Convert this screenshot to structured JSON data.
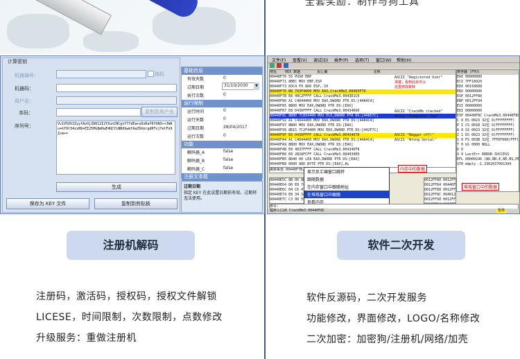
{
  "top_right": {
    "caption": "全套奖励：制作与狗工具"
  },
  "keygen": {
    "group_title": "计算密钥",
    "fields": [
      {
        "label": "机器编号：",
        "value": "",
        "checkbox": "随机"
      },
      {
        "label": "机器码：",
        "value": ""
      },
      {
        "label": "用户名：",
        "value": ""
      },
      {
        "label": "本码：",
        "value": "",
        "button": "复制到用户名"
      }
    ],
    "serial_label": "序列号：",
    "serial_value": "Vv1V5OV2ZyyfAvOjZ8812I2YXunCNCgvY7fdEa+vDoRaY6YhN3++JWAu+kY9l34zsN9+EI25HG8mDwE4QCYiNNXGwmfAaZ6kkrgdRTvjYetFn9Zcm+=",
    "generate_button": "生成",
    "save_button": "保存为 KEY 文件",
    "copy_button": "复制到剪贴板",
    "section_basic_title": "基础信息",
    "basic_items": [
      {
        "label": "有效天数",
        "value": "0"
      },
      {
        "label": "过期日期",
        "value": "31/10/2030"
      },
      {
        "label": "执行次数",
        "value": "0"
      }
    ],
    "section_run_title": "运行限制",
    "run_items": [
      {
        "label": "运行时间",
        "value": "0"
      },
      {
        "label": "运行天数",
        "value": "0"
      },
      {
        "label": "过期日期",
        "value": "28/04/2017"
      },
      {
        "label": "运行次数",
        "value": "0"
      }
    ],
    "section_feature_title": "功能",
    "feature_items": [
      {
        "label": "解码器_A",
        "value": "false"
      },
      {
        "label": "解码器_B",
        "value": "false"
      },
      {
        "label": "解码器_C",
        "value": "false"
      }
    ],
    "notes_title": "注册文本框",
    "desc_title": "过期日期",
    "desc_text": "指定 KEY 在此设置日期前有效，过期将无法使用。"
  },
  "olly": {
    "menubar": [
      "文件(F)",
      "查看(V)",
      "调试(D)",
      "插件(P)",
      "选项(T)",
      "窗口(W)",
      "帮助(H)"
    ],
    "col_headers": [
      "地址",
      "HEX 数据",
      "反汇编",
      "注释",
      "寄存器 (FPU)"
    ],
    "code_rows": [
      "00440F70  55        PUSH EBP",
      "00440F71  8BEC      MOV EBP,ESP",
      "00440F73  83C4 F0   ADD ESP,-10",
      "00440F76  B8 703F4000 MOV EAX,CrackMe3.00403F70",
      "00440F7B  E8 40C2FFFF CALL CrackMe3.0043D1C0",
      "00440F80  A1 C4844400 MOV EAX,DWORD PTR DS:[4484C4]",
      "00440F85  8B00      MOV EAX,DWORD PTR DS:[EAX]",
      "00440F87  E8 D436FFFF CALL CrackMe3.00434660",
      "00440F8C  8B0D 7C854400 MOV ECX,DWORD PTR DS:[44857C]",
      "00440F92  A1 C4844400 MOV EAX,DWORD PTR DS:[4484C4]",
      "00440F97  8B00      MOV EAX,DWORD PTR DS:[EAX]",
      "00440F99  8B15 7C2F4400 MOV EDX,DWORD PTR DS:[442F7C]",
      "00440F9F  E8 D436FFFF CALL CrackMe3.00434678",
      "00440FA4  A1 C4844400 MOV EAX,DWORD PTR DS:[4484C4]",
      "00440FA9  8B00      MOV EAX,DWORD PTR DS:[EAX]",
      "00440FAB  E8 4837FFFF CALL CrackMe3.004346F8",
      "00440FB0  E8 2B2AFCFF CALL CrackMe3.004039E0",
      "00440FB5  8D40 00   LEA EAX,DWORD PTR DS:[EAX]",
      "00440FB8  0000      ADD BYTE PTR DS:[EAX],AL",
      "00440FBA  0000      ADD BYTE PTR DS:[EAX],AL",
      "00440FBC  0000      ADD BYTE PTR DS:[EAX],AL",
      "00440FBE  0000      ADD BYTE PTR DS:[EAX],AL",
      "00440FC0  6A 00     PUSH 0",
      "00440FC2  68 5C104400 PUSH CrackMe3.0044105C",
      "00440FC7  68 A0104400 PUSH CrackMe3.004410A0",
      "00440FCC  A1 C4844400 MOV EAX,DWORD PTR DS:[4484C4]",
      "00440FD1  8B00      MOV EAX,DWORD PTR DS:[EAX]",
      "00440FD3  E8 8C39FFFF CALL CrackMe3.00434964"
    ],
    "comments": [
      "ASCII \"Registered User\"",
      "关键，看到此处可以",
      "这里修改跳转",
      "",
      "ASCII \"CrackMe cracked\"",
      "ASCII \"Congrats! You\"",
      "",
      "ASCII \"Beggar off!\"",
      "ASCII \"Wrong Serial\""
    ],
    "registers": [
      "EAX 00000000",
      "ECX 7FF18920",
      "EDX 00150608",
      "EBX 00000000",
      "ESP 0012FF80",
      "EBP 0012FF94",
      "ESI 00000000",
      "EDI 00000000",
      "EIP 00440F8C CrackMe3.00440F8C",
      "C 0  ES 0023 32位 0(FFFFFFFF)",
      "P 1  CS 001B 32位 0(FFFFFFFF)",
      "A 0  SS 0023 32位 0(FFFFFFFF)",
      "Z 1  DS 0023 32位 0(FFFFFFFF)",
      "S 0  FS 003B 32位 7FFDF000(FFF)",
      "T 0  GS 0000 NULL",
      "D 0",
      "O 0  LastErr ERROR_SUCCESS",
      "EFL 00000246 (NO,NB,E,BE,NS,PE,GE,LE)",
      "ST0 empty -1.3302037001394"
    ],
    "info_line": "跳转来自 00440F7B, 00440E84",
    "context_menu": [
      "显示反汇编窗口跳转",
      "跟随数据",
      "在内存窗口中跟随地址",
      "在堆栈窗口中跟随",
      "查看内存"
    ],
    "context_selected": 3,
    "annot_1": "内存中的数据",
    "annot_2": "堆栈窗口中的数据",
    "dump_rows": [
      "00440E5C 8B 06 8B 15 7C 2F  .i..|/D.",
      "00440E64 00 E8 74 54 44 00  .?T.D.",
      "00440E6C 04 C6 47 4E 00 8B  ..GN...",
      "00440E74 E8 34 3A FF FF 5B  ?:..[",
      "00440E7C C3 90 55 8B EC 6A  ?U.?j"
    ],
    "stack_rows": [
      "0012FF80 0012FFA4",
      "0012FF84 00440F92",
      "0012FF88 0012FF94",
      "0012FF8C 00401234",
      "0012FF90 0012FFB0",
      "0012FF94 0012FFC0",
      "0012FF98 7C816D4F"
    ],
    "command_bar": "命令：",
    "status": "程序入口点 CrackMe3.00440F8C",
    "status_right": "暂停"
  },
  "left_section": {
    "title": "注册机解码",
    "lines": [
      "注册码，激活码，授权码，授权文件解锁",
      "LICESE，时间限制，次数限制，点数修改",
      "升级服务：重做注册机"
    ]
  },
  "right_section": {
    "title": "软件二次开发",
    "lines": [
      "软件反源码，二次开发服务",
      "功能修改，界面修改，LOGO/名称修改",
      "二次加密：加密狗/注册机/网络/加壳"
    ]
  }
}
